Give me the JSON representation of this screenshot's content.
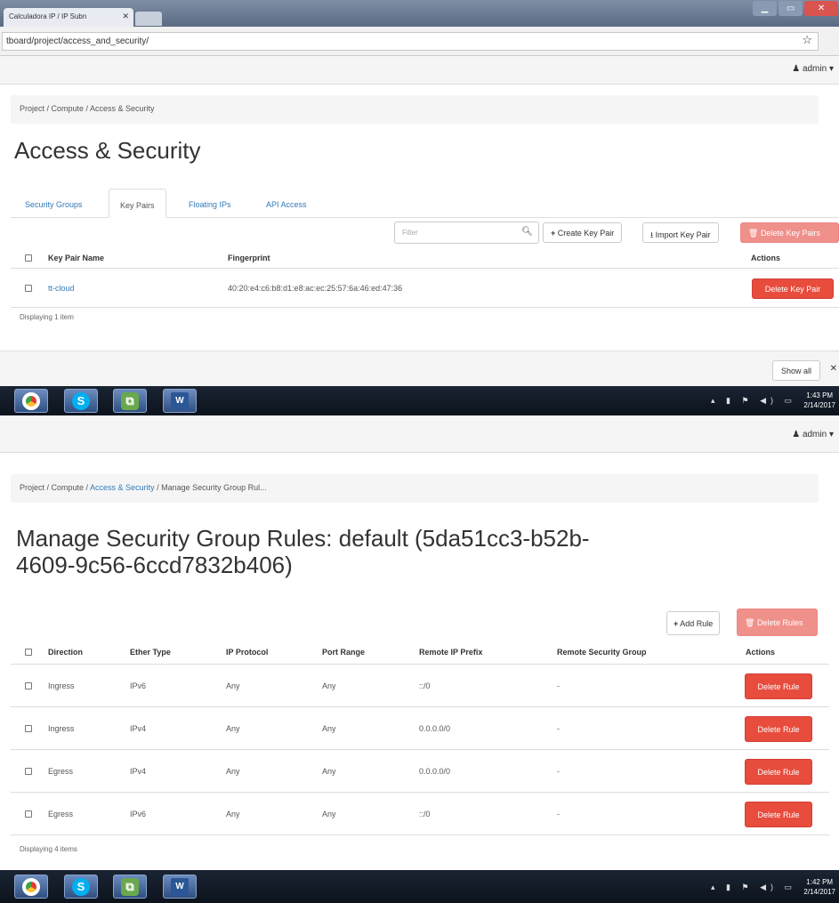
{
  "browser": {
    "tab_title": "Calculadora IP / IP Subn",
    "tab_close": "✕",
    "url": "tboard/project/access_and_security/",
    "star": "☆",
    "window_controls": [
      "▁",
      "▭",
      "✕"
    ]
  },
  "top1": {
    "user": "admin",
    "breadcrumb": "Project / Compute / Access & Security",
    "heading": "Access & Security",
    "tabs": [
      "Security Groups",
      "Key Pairs",
      "Floating IPs",
      "API Access"
    ],
    "filter_placeholder": "Filter",
    "buttons": {
      "create": "Create Key Pair",
      "import": "Import Key Pair",
      "delete": "Delete Key Pairs"
    },
    "columns": [
      "Key Pair Name",
      "Fingerprint",
      "Actions"
    ],
    "rows": [
      {
        "name": "tt-cloud",
        "fingerprint": "40:20:e4:c6:b8:d1:e8:ac:ec:25:57:6a:46:ed:47:36",
        "action": "Delete Key Pair"
      }
    ],
    "footer": "Displaying 1 item",
    "show_all": "Show all"
  },
  "taskbar1": {
    "time": "1:43 PM",
    "date": "2/14/2017"
  },
  "top2": {
    "user": "admin",
    "breadcrumb_prefix": "Project / Compute / ",
    "breadcrumb_link": "Access & Security",
    "breadcrumb_suffix": " / Manage Security Group Rul...",
    "heading_line1": "Manage Security Group Rules: default (5da51cc3-b52b-",
    "heading_line2": "4609-9c56-6ccd7832b406)",
    "buttons": {
      "add": "Add Rule",
      "delete": "Delete Rules"
    },
    "columns": [
      "Direction",
      "Ether Type",
      "IP Protocol",
      "Port Range",
      "Remote IP Prefix",
      "Remote Security Group",
      "Actions"
    ],
    "rows": [
      {
        "direction": "Ingress",
        "ether": "IPv6",
        "protocol": "Any",
        "port": "Any",
        "prefix": "::/0",
        "group": "-",
        "action": "Delete Rule"
      },
      {
        "direction": "Ingress",
        "ether": "IPv4",
        "protocol": "Any",
        "port": "Any",
        "prefix": "0.0.0.0/0",
        "group": "-",
        "action": "Delete Rule"
      },
      {
        "direction": "Egress",
        "ether": "IPv4",
        "protocol": "Any",
        "port": "Any",
        "prefix": "0.0.0.0/0",
        "group": "-",
        "action": "Delete Rule"
      },
      {
        "direction": "Egress",
        "ether": "IPv6",
        "protocol": "Any",
        "port": "Any",
        "prefix": "::/0",
        "group": "-",
        "action": "Delete Rule"
      }
    ],
    "footer": "Displaying 4 items"
  },
  "taskbar2": {
    "time": "1:42 PM",
    "date": "2/14/2017"
  },
  "icons": [
    "chrome-icon",
    "skype-icon",
    "vmware-icon",
    "word-icon"
  ]
}
